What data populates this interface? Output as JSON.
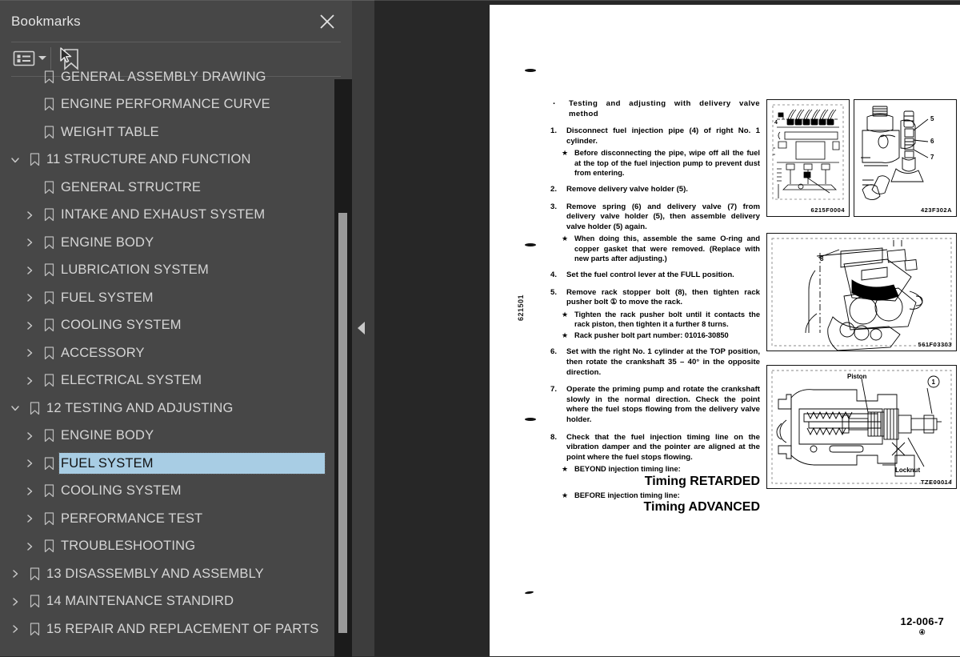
{
  "panel": {
    "title": "Bookmarks",
    "close_icon": "close-icon",
    "toolbar": {
      "options_icon": "list-options-icon",
      "options_caret_icon": "chevron-down-icon",
      "new_bookmark_icon": "new-bookmark-icon"
    },
    "collapse_handle_icon": "collapse-left-triangle-icon",
    "tree": [
      {
        "label": "GENERAL ASSEMBLY DRAWING",
        "level": 1,
        "twisty": "none",
        "selected": false,
        "clipped": true
      },
      {
        "label": "ENGINE PERFORMANCE CURVE",
        "level": 1,
        "twisty": "none",
        "selected": false
      },
      {
        "label": "WEIGHT TABLE",
        "level": 1,
        "twisty": "none",
        "selected": false
      },
      {
        "label": "11 STRUCTURE AND FUNCTION",
        "level": 0,
        "twisty": "expanded",
        "selected": false
      },
      {
        "label": "GENERAL STRUCTRE",
        "level": 1,
        "twisty": "none",
        "selected": false
      },
      {
        "label": "INTAKE AND EXHAUST SYSTEM",
        "level": 1,
        "twisty": "collapsed",
        "selected": false
      },
      {
        "label": "ENGINE BODY",
        "level": 1,
        "twisty": "collapsed",
        "selected": false
      },
      {
        "label": "LUBRICATION SYSTEM",
        "level": 1,
        "twisty": "collapsed",
        "selected": false
      },
      {
        "label": "FUEL SYSTEM",
        "level": 1,
        "twisty": "collapsed",
        "selected": false
      },
      {
        "label": "COOLING SYSTEM",
        "level": 1,
        "twisty": "collapsed",
        "selected": false
      },
      {
        "label": "ACCESSORY",
        "level": 1,
        "twisty": "collapsed",
        "selected": false
      },
      {
        "label": "ELECTRICAL SYSTEM",
        "level": 1,
        "twisty": "collapsed",
        "selected": false
      },
      {
        "label": "12 TESTING AND ADJUSTING",
        "level": 0,
        "twisty": "expanded",
        "selected": false
      },
      {
        "label": "ENGINE BODY",
        "level": 1,
        "twisty": "collapsed",
        "selected": false
      },
      {
        "label": "FUEL SYSTEM",
        "level": 1,
        "twisty": "collapsed",
        "selected": true
      },
      {
        "label": "COOLING SYSTEM",
        "level": 1,
        "twisty": "collapsed",
        "selected": false
      },
      {
        "label": "PERFORMANCE TEST",
        "level": 1,
        "twisty": "collapsed",
        "selected": false
      },
      {
        "label": "TROUBLESHOOTING",
        "level": 1,
        "twisty": "collapsed",
        "selected": false
      },
      {
        "label": "13 DISASSEMBLY AND ASSEMBLY",
        "level": 0,
        "twisty": "collapsed",
        "selected": false
      },
      {
        "label": "14 MAINTENANCE STANDIRD",
        "level": 0,
        "twisty": "collapsed",
        "selected": false
      },
      {
        "label": "15 REPAIR AND REPLACEMENT OF PARTS",
        "level": 0,
        "twisty": "collapsed",
        "selected": false
      }
    ]
  },
  "document": {
    "side_code": "621501",
    "page_number": "12-006-7",
    "page_number_circled": "④",
    "blocks": [
      {
        "marker": "·",
        "text": "Testing and adjusting with delivery valve method",
        "stars": []
      },
      {
        "marker": "1.",
        "text": "Disconnect fuel injection pipe (4) of right No. 1 cylinder.",
        "stars": [
          "Before disconnecting the pipe, wipe off all the fuel at the top of the fuel injection pump to prevent dust from entering."
        ]
      },
      {
        "marker": "2.",
        "text": "Remove delivery valve holder (5).",
        "stars": []
      },
      {
        "marker": "3.",
        "text": "Remove spring (6) and delivery valve (7) from delivery valve holder (5), then assemble delivery valve holder (5) again.",
        "stars": [
          "When doing this, assemble the same O-ring and copper gasket that were removed.  (Replace with new parts after adjusting.)"
        ]
      },
      {
        "marker": "4.",
        "text": "Set the fuel control lever at the FULL position.",
        "stars": []
      },
      {
        "marker": "5.",
        "text": "Remove rack stopper bolt (8), then tighten rack pusher bolt ① to move the rack.",
        "stars": [
          "Tighten the rack pusher bolt until it contacts the rack piston, then tighten it a further 8 turns.",
          "Rack pusher bolt part number: 01016-30850"
        ]
      },
      {
        "marker": "6.",
        "text": "Set with the right No. 1 cylinder at the TOP position, then rotate the crankshaft 35 – 40° in the opposite direction.",
        "stars": []
      },
      {
        "marker": "7.",
        "text": "Operate the priming pump and rotate the crankshaft slowly in the normal direction.  Check the point where the fuel stops flowing from the delivery valve holder.",
        "stars": []
      },
      {
        "marker": "8.",
        "text": "Check that the fuel injection timing line on the vibration damper and the pointer are aligned at the point where the fuel stops flowing.",
        "stars": [
          "BEYOND injection timing line:",
          "BEFORE injection timing line:"
        ],
        "star_rights": [
          "Timing RETARDED",
          "Timing ADVANCED"
        ]
      }
    ],
    "figures": [
      {
        "code": "6215F0004",
        "labels": [
          "4"
        ]
      },
      {
        "code": "423F302A",
        "labels": [
          "5",
          "6",
          "7"
        ]
      },
      {
        "code": "561F03303",
        "labels": [
          "8"
        ]
      },
      {
        "code": "TZE00014",
        "labels": [
          "Piston",
          "Locknut",
          "①"
        ]
      }
    ]
  }
}
